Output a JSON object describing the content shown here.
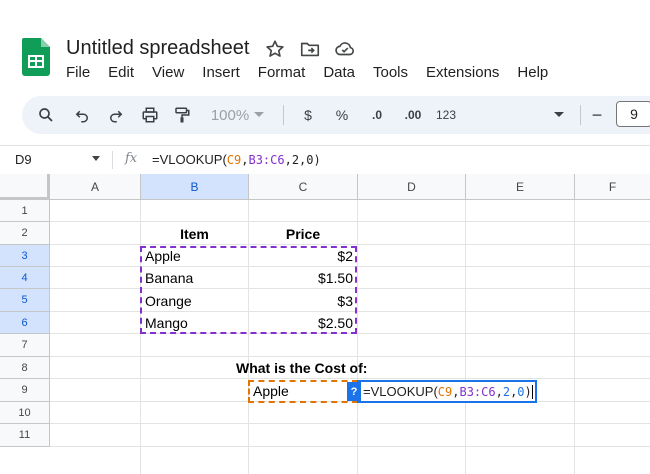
{
  "app": {
    "title": "Untitled spreadsheet",
    "menu": [
      "File",
      "Edit",
      "View",
      "Insert",
      "Format",
      "Data",
      "Tools",
      "Extensions",
      "Help"
    ]
  },
  "toolbar": {
    "zoom": "100%",
    "currency": "$",
    "percent": "%",
    "decrease_decimal": ".0",
    "increase_decimal": ".00",
    "number_format": "123",
    "font_size": "9",
    "minus": "−"
  },
  "formula_bar": {
    "name_box": "D9",
    "fx": "fx",
    "prefix": "=VLOOKUP(",
    "arg1": "C9",
    "comma1": ",",
    "arg2": "B3:C6",
    "rest": ",2,0)"
  },
  "columns": [
    "A",
    "B",
    "C",
    "D",
    "E",
    "F"
  ],
  "rows": [
    "1",
    "2",
    "3",
    "4",
    "5",
    "6",
    "7",
    "8",
    "9",
    "10",
    "11"
  ],
  "cells": {
    "B2": "Item",
    "C2": "Price",
    "B3": "Apple",
    "C3": "$2",
    "B4": "Banana",
    "C4": "$1.50",
    "B5": "Orange",
    "C5": "$3",
    "B6": "Mango",
    "C6": "$2.50",
    "C8": "What is the Cost of:",
    "C9": "Apple"
  },
  "cell_editor": {
    "hint": "?",
    "prefix": "=VLOOKUP(",
    "arg1": "C9",
    "comma1": ",",
    "arg2": "B3:C6",
    "comma2": ",",
    "arg3": "2",
    "comma3": ",",
    "arg4": "0",
    "close": ")"
  },
  "colors": {
    "accent_blue": "#1a73e8",
    "ref_orange": "#e37400",
    "ref_purple": "#8430ce",
    "selected_header": "#d3e3fd",
    "sheets_green": "#0f9d58"
  }
}
